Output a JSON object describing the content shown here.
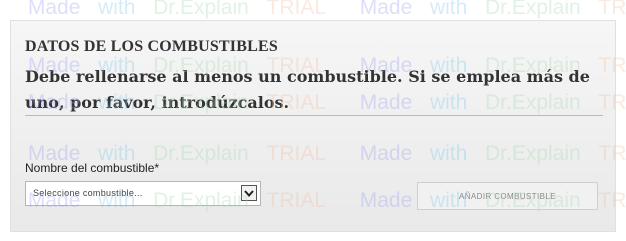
{
  "section": {
    "title": "DATOS DE LOS COMBUSTIBLES",
    "description": "Debe rellenarse al menos un combustible. Si se emplea más de uno, por favor, introdúzcalos."
  },
  "fuel_field": {
    "label": "Nombre del combustible*",
    "selected_value": "Seleccione combustible..."
  },
  "add_button": {
    "label": "AÑADIR COMBUSTIBLE"
  },
  "watermark": {
    "made": "Made",
    "with": "with",
    "brand": "Dr.Explain",
    "trial": "TRIAL"
  },
  "icons": {
    "dropdown": "chevron-down-icon"
  },
  "colors": {
    "panel_bg": "#efefef",
    "text": "#333333",
    "button_text": "#8a8a8a"
  }
}
